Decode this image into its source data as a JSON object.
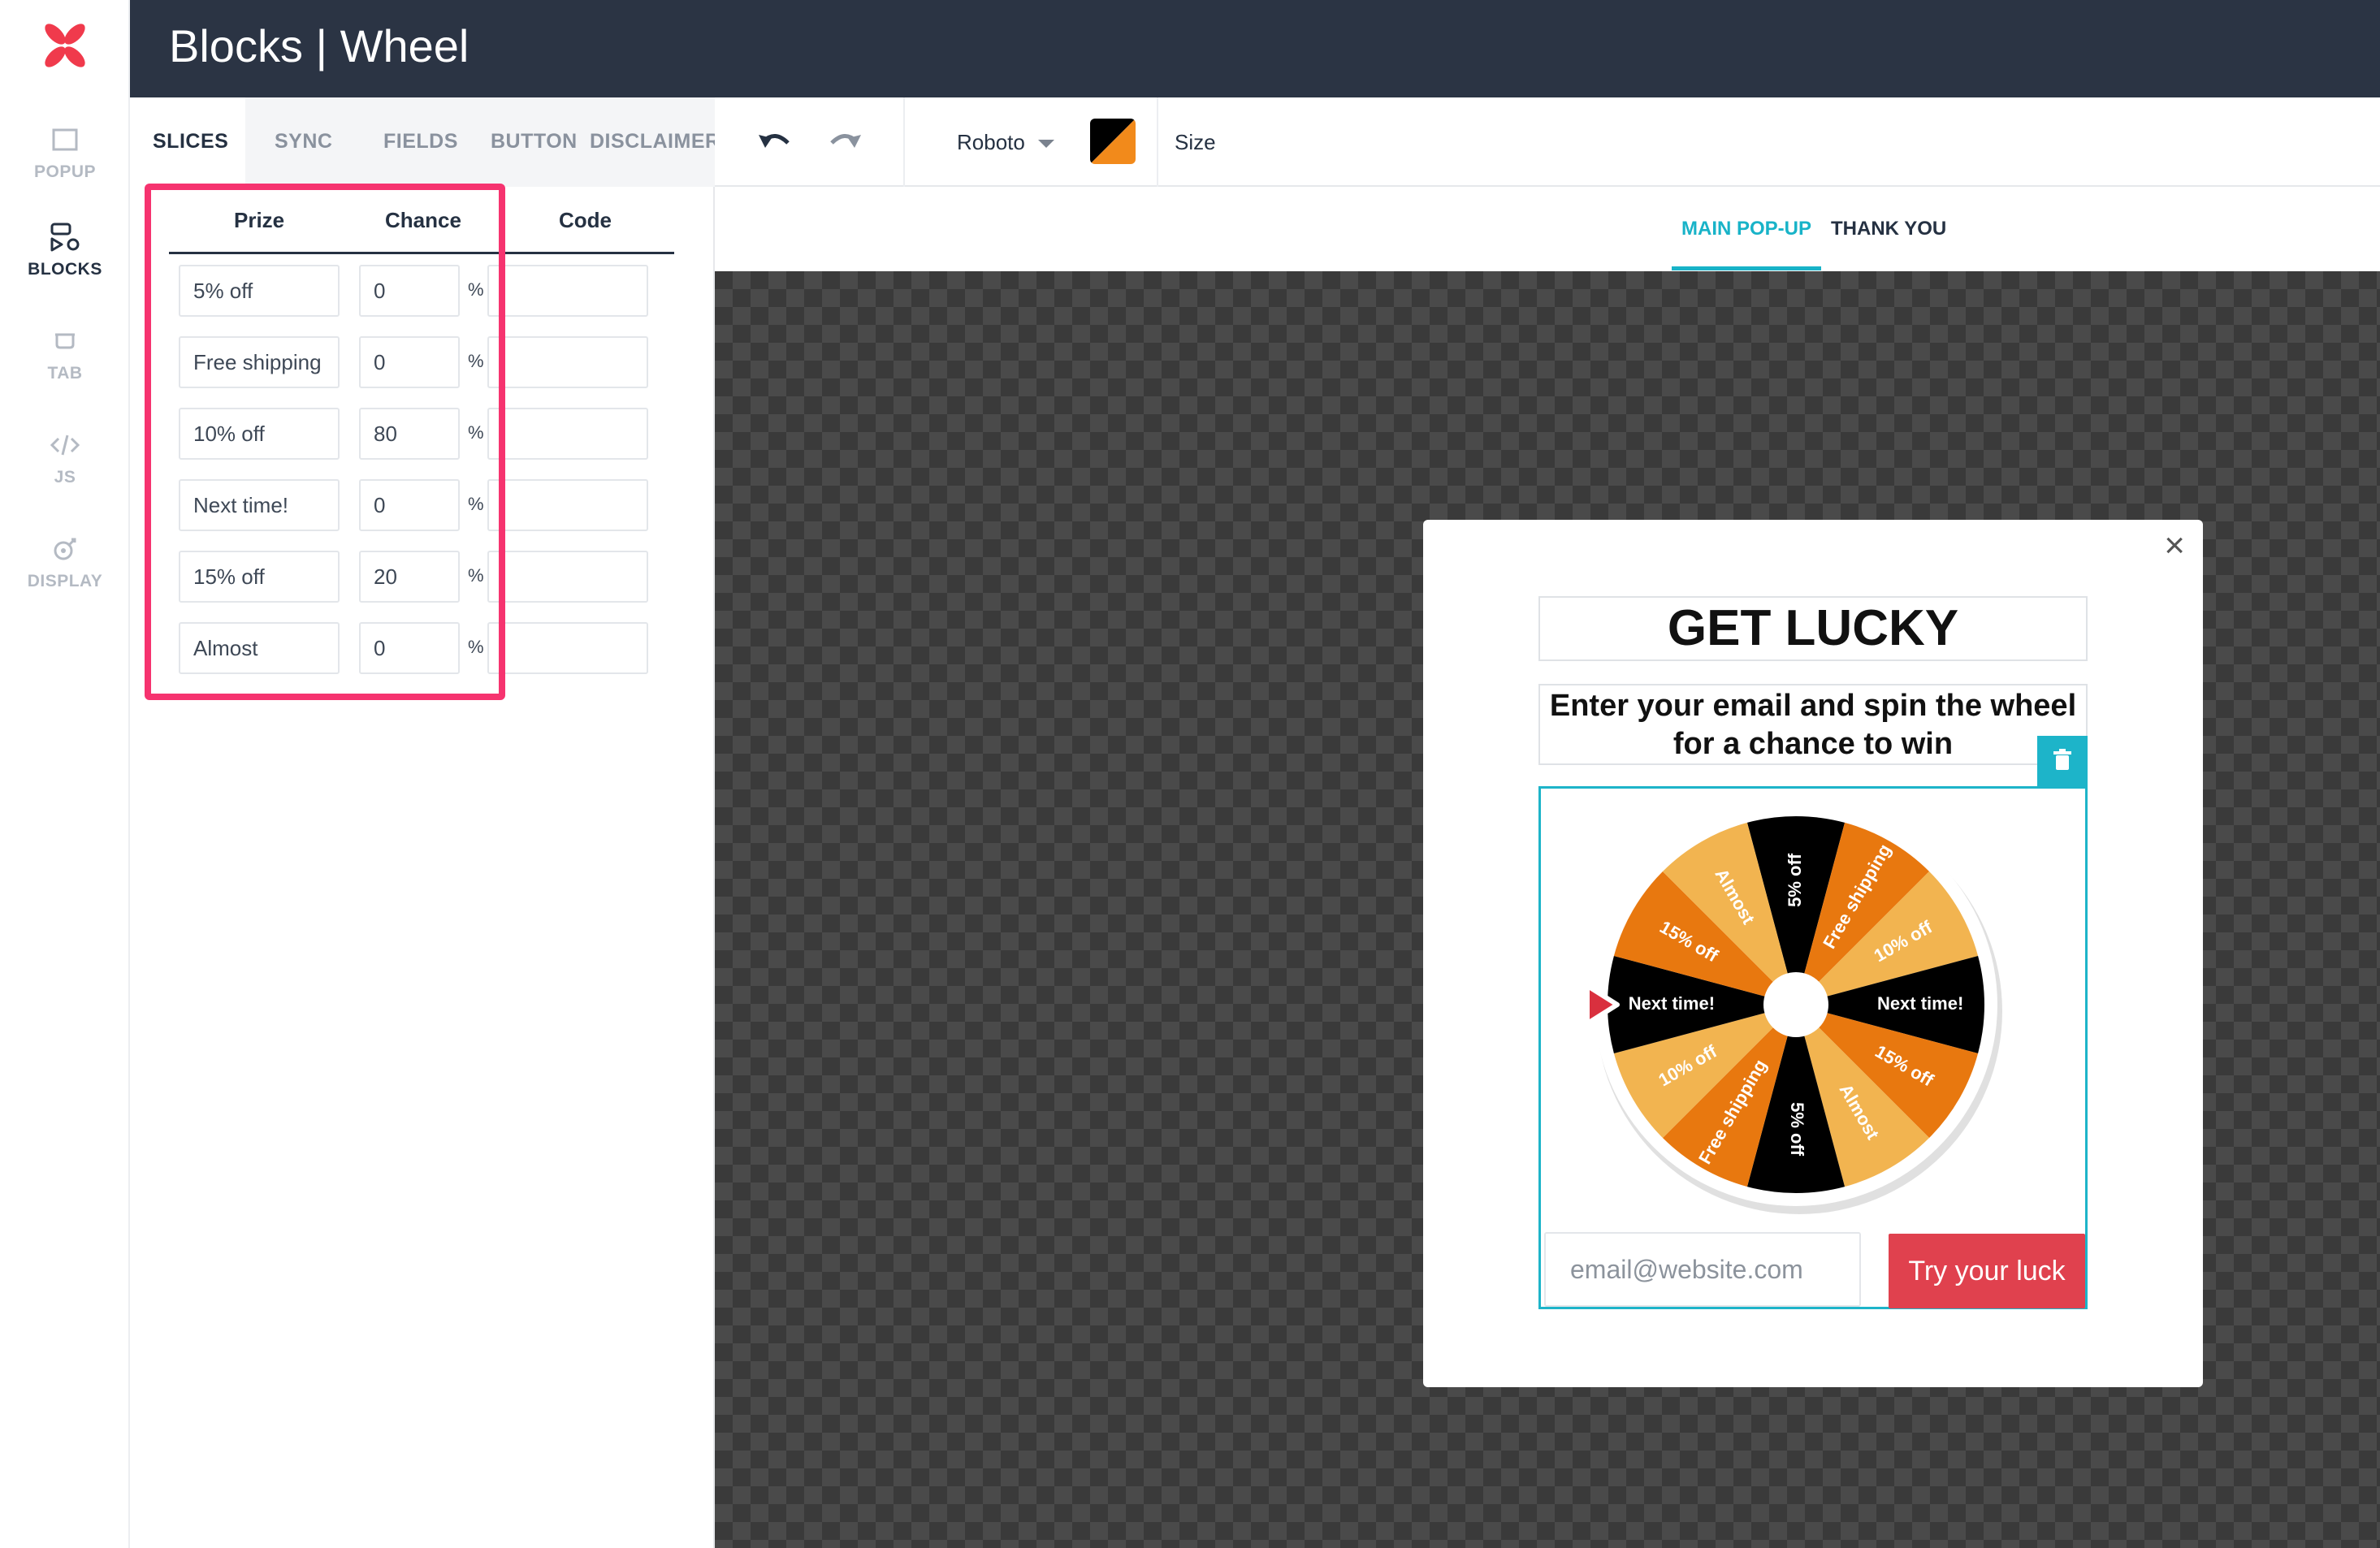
{
  "app": {
    "title": "Blocks | Wheel"
  },
  "rail": [
    {
      "label": "POPUP",
      "active": false
    },
    {
      "label": "BLOCKS",
      "active": true
    },
    {
      "label": "TAB",
      "active": false
    },
    {
      "label": "JS",
      "active": false
    },
    {
      "label": "DISPLAY",
      "active": false
    }
  ],
  "tabs": [
    "SLICES",
    "SYNC",
    "FIELDS",
    "BUTTON",
    "DISCLAIMER"
  ],
  "table": {
    "headers": {
      "prize": "Prize",
      "chance": "Chance",
      "code": "Code"
    },
    "percent_sign": "%",
    "rows": [
      {
        "prize": "5% off",
        "chance": "0",
        "code": ""
      },
      {
        "prize": "Free shipping",
        "chance": "0",
        "code": ""
      },
      {
        "prize": "10% off",
        "chance": "80",
        "code": ""
      },
      {
        "prize": "Next time!",
        "chance": "0",
        "code": ""
      },
      {
        "prize": "15% off",
        "chance": "20",
        "code": ""
      },
      {
        "prize": "Almost",
        "chance": "0",
        "code": ""
      }
    ]
  },
  "toolbar": {
    "font": "Roboto",
    "size_label": "Size",
    "color_a": "#000000",
    "color_b": "#f28a1b"
  },
  "view_tabs": {
    "main": "MAIN POP-UP",
    "thanks": "THANK YOU"
  },
  "popup": {
    "heading": "GET LUCKY",
    "subheading_line1": "Enter your email and spin the wheel",
    "subheading_line2": "for a chance to win",
    "email_placeholder": "email@website.com",
    "button_label": "Try your luck",
    "close_glyph": "×"
  },
  "wheel": {
    "slices": [
      {
        "label": "5% off",
        "color": "#000000",
        "text": "#ffffff"
      },
      {
        "label": "Free shipping",
        "color": "#e8780f",
        "text": "#ffffff"
      },
      {
        "label": "10% off",
        "color": "#f2b450",
        "text": "#ffffff"
      },
      {
        "label": "Next time!",
        "color": "#000000",
        "text": "#ffffff"
      },
      {
        "label": "15% off",
        "color": "#e8780f",
        "text": "#ffffff"
      },
      {
        "label": "Almost",
        "color": "#f2b450",
        "text": "#ffffff"
      },
      {
        "label": "5% off",
        "color": "#000000",
        "text": "#ffffff"
      },
      {
        "label": "Free shipping",
        "color": "#e8780f",
        "text": "#ffffff"
      },
      {
        "label": "10% off",
        "color": "#f2b450",
        "text": "#ffffff"
      },
      {
        "label": "Next time!",
        "color": "#000000",
        "text": "#ffffff"
      },
      {
        "label": "15% off",
        "color": "#e8780f",
        "text": "#ffffff"
      },
      {
        "label": "Almost",
        "color": "#f2b450",
        "text": "#ffffff"
      }
    ],
    "accent": "#1db4c9",
    "pointer_color": "#d9303e"
  }
}
